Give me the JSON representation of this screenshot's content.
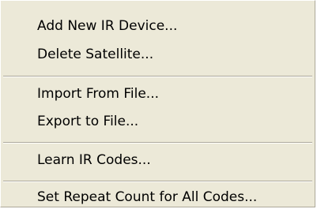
{
  "menu": {
    "items": [
      {
        "label": "Add New IR Device..."
      },
      {
        "label": "Delete Satellite..."
      },
      {
        "label": "Import From File..."
      },
      {
        "label": "Export to File..."
      },
      {
        "label": "Learn IR Codes..."
      },
      {
        "label": "Set Repeat Count for All Codes..."
      }
    ]
  }
}
